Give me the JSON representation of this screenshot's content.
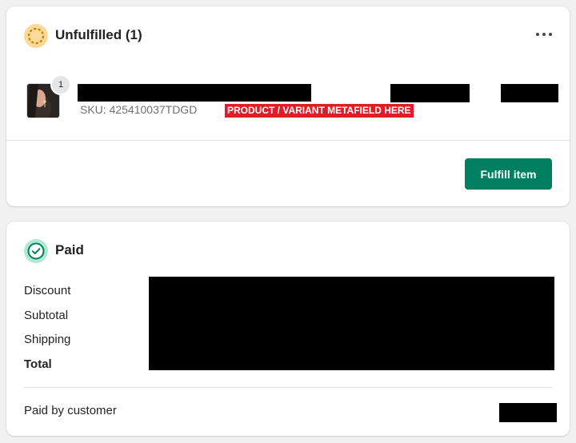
{
  "colors": {
    "primary": "#008060",
    "unfulfilled_badge": "#fcd99a",
    "unfulfilled_ring": "#b98900",
    "paid_badge": "#aee9d1",
    "paid_ring": "#007f5f",
    "metafield_bg": "#e11b2a"
  },
  "unfulfilled_card": {
    "status_icon": "incomplete-circle-icon",
    "title": "Unfulfilled (1)",
    "menu_icon": "horizontal-dots-icon",
    "line_item": {
      "quantity": "1",
      "sku": "SKU: 425410037TDGD",
      "metafield_label": "PRODUCT / VARIANT METAFIELD HERE"
    },
    "fulfill_button": "Fulfill item"
  },
  "paid_card": {
    "status_icon": "checkmark-circle-icon",
    "title": "Paid",
    "rows": [
      {
        "label": "Discount"
      },
      {
        "label": "Subtotal"
      },
      {
        "label": "Shipping"
      },
      {
        "label": "Total"
      }
    ],
    "paid_by_label": "Paid by customer"
  }
}
